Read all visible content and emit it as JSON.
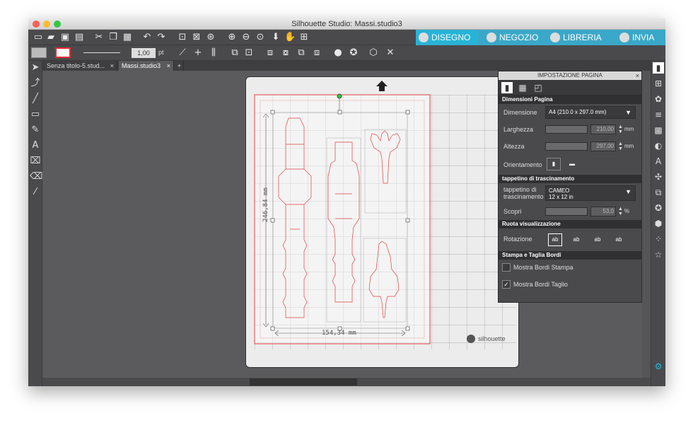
{
  "window": {
    "title": "Silhouette Studio: Massi.studio3"
  },
  "nav": {
    "tabs": [
      {
        "label": "DISEGNO",
        "active": true
      },
      {
        "label": "NEGOZIO",
        "active": false
      },
      {
        "label": "LIBRERIA",
        "active": false
      },
      {
        "label": "INVIA",
        "active": false
      }
    ],
    "accent": "#27b4d8"
  },
  "toolbar2": {
    "line_width": "1,00",
    "line_unit": "pt"
  },
  "doc_tabs": [
    {
      "label": "Senza titolo-5.stud...",
      "close": "×"
    },
    {
      "label": "Massi.studio3",
      "close": "×"
    },
    {
      "label": "+"
    }
  ],
  "canvas": {
    "dim_height": "246,84 mm",
    "dim_width": "154,34 mm",
    "brand": "silhouette"
  },
  "panel": {
    "title": "IMPOSTAZIONE PAGINA",
    "close": "×",
    "sections": {
      "page_dimensions": "Dimensioni Pagina",
      "cutting_mat": "tappetino di trascinamento",
      "rotate_view": "Ruota visualizzazione",
      "print_cut": "Stampa e Taglia Bordi"
    },
    "dimension_label": "Dimensione",
    "dimension_value": "A4 (210.0 x 297.0 mm)",
    "width_label": "Larghezza",
    "width_value": "210,00",
    "height_label": "Altezza",
    "height_value": "297,00",
    "unit_mm": "mm",
    "orientation_label": "Orientamento",
    "mat_label": "tappetino di trascinamento",
    "mat_value_line1": "CAMEO",
    "mat_value_line2": "12 x 12 in",
    "reveal_label": "Scopri",
    "reveal_value": "53,0",
    "unit_pct": "%",
    "rotation_label": "Rotazione",
    "rotations": [
      "ab",
      "ab",
      "ab",
      "ab"
    ],
    "show_print_borders": {
      "label": "Mostra Bordi Stampa",
      "checked": false
    },
    "show_cut_borders": {
      "label": "Mostra Bordi Taglio",
      "checked": true
    }
  }
}
